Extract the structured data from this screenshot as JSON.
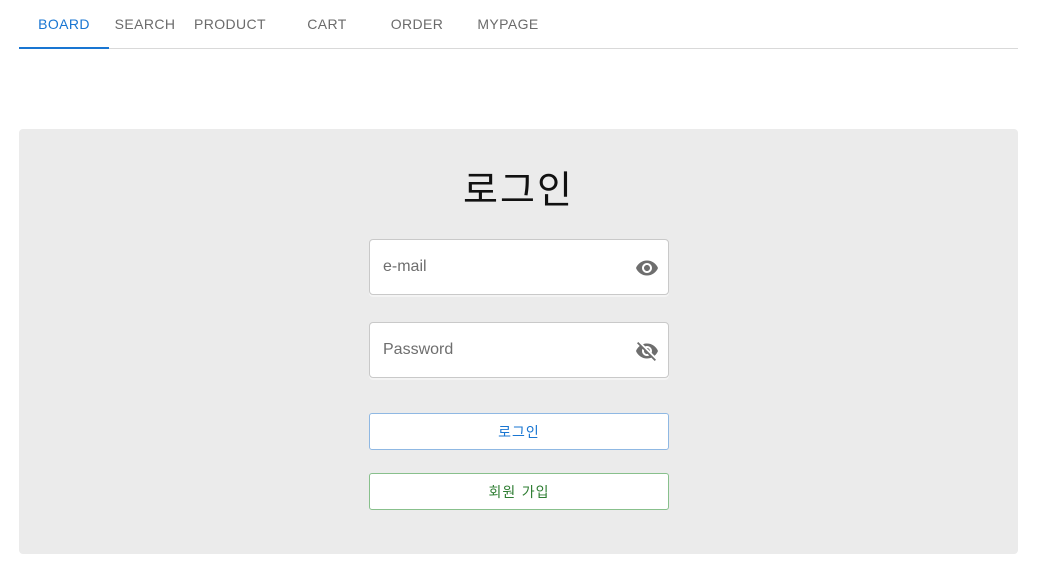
{
  "nav": {
    "tabs": [
      {
        "label": "BOARD",
        "active": true
      },
      {
        "label": "SEARCH",
        "active": false
      },
      {
        "label": "PRODUCT",
        "active": false
      },
      {
        "label": "CART",
        "active": false
      },
      {
        "label": "ORDER",
        "active": false
      },
      {
        "label": "MYPAGE",
        "active": false
      }
    ]
  },
  "login": {
    "title": "로그인",
    "email": {
      "placeholder": "e-mail",
      "value": "",
      "icon": "eye-icon"
    },
    "password": {
      "placeholder": "Password",
      "value": "",
      "icon": "eye-off-icon"
    },
    "login_button": "로그인",
    "signup_button": "회원 가입"
  },
  "colors": {
    "accent": "#1976d2",
    "success": "#2e7d32",
    "panel_bg": "#ebebeb"
  }
}
